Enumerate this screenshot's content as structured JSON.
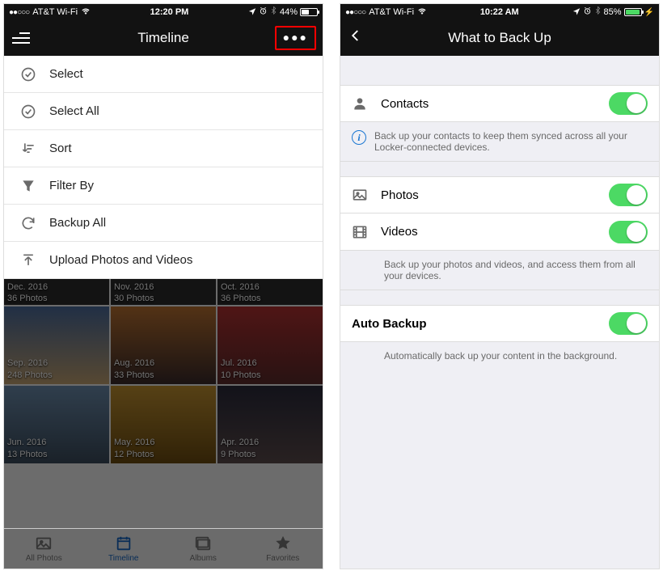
{
  "left": {
    "status": {
      "carrier": "AT&T Wi-Fi",
      "time": "12:20 PM",
      "battery_pct": "44%",
      "battery_fill_pct": 44
    },
    "nav": {
      "title": "Timeline"
    },
    "menu": [
      {
        "key": "select",
        "label": "Select"
      },
      {
        "key": "select-all",
        "label": "Select All"
      },
      {
        "key": "sort",
        "label": "Sort"
      },
      {
        "key": "filter",
        "label": "Filter By"
      },
      {
        "key": "backup-all",
        "label": "Backup All"
      },
      {
        "key": "upload",
        "label": "Upload Photos and Videos"
      }
    ],
    "grid_headers": [
      {
        "month": "Dec. 2016",
        "count": "36 Photos"
      },
      {
        "month": "Nov. 2016",
        "count": "30 Photos"
      },
      {
        "month": "Oct. 2016",
        "count": "36 Photos"
      }
    ],
    "grid_cells": [
      {
        "month": "Sep. 2016",
        "count": "248 Photos"
      },
      {
        "month": "Aug. 2016",
        "count": "33 Photos"
      },
      {
        "month": "Jul. 2016",
        "count": "10 Photos"
      },
      {
        "month": "Jun. 2016",
        "count": "13 Photos"
      },
      {
        "month": "May. 2016",
        "count": "12 Photos"
      },
      {
        "month": "Apr. 2016",
        "count": "9 Photos"
      }
    ],
    "tabs": [
      {
        "key": "all",
        "label": "All Photos"
      },
      {
        "key": "timeline",
        "label": "Timeline"
      },
      {
        "key": "albums",
        "label": "Albums"
      },
      {
        "key": "favorites",
        "label": "Favorites"
      }
    ],
    "active_tab": "timeline"
  },
  "right": {
    "status": {
      "carrier": "AT&T Wi-Fi",
      "time": "10:22 AM",
      "battery_pct": "85%",
      "battery_fill_pct": 85
    },
    "nav": {
      "title": "What to Back Up"
    },
    "rows": {
      "contacts": {
        "label": "Contacts"
      },
      "photos": {
        "label": "Photos"
      },
      "videos": {
        "label": "Videos"
      },
      "auto": {
        "label": "Auto Backup"
      }
    },
    "info_contacts": "Back up your contacts to keep them synced across all your Locker-connected devices.",
    "info_media": "Back up your photos and videos, and access them from all your devices.",
    "info_auto": "Automatically back up your content in the background."
  }
}
